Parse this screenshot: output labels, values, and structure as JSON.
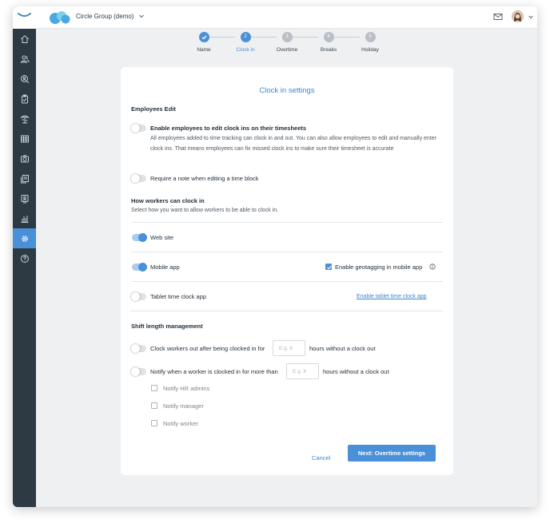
{
  "header": {
    "company_name": "Circle Group (demo)"
  },
  "sidebar": {
    "items": [
      {
        "icon": "home-icon"
      },
      {
        "icon": "users-icon"
      },
      {
        "icon": "search-user-icon"
      },
      {
        "icon": "clipboard-icon"
      },
      {
        "icon": "vacation-icon"
      },
      {
        "icon": "schedule-grid-icon"
      },
      {
        "icon": "camera-icon"
      },
      {
        "icon": "documents-icon"
      },
      {
        "icon": "id-badge-icon"
      },
      {
        "icon": "reports-chart-icon"
      },
      {
        "icon": "settings-gear-icon",
        "active": true
      },
      {
        "icon": "help-icon"
      }
    ]
  },
  "steps": [
    {
      "label": "Name",
      "state": "done",
      "num": ""
    },
    {
      "label": "Clock in",
      "state": "current",
      "num": "2"
    },
    {
      "label": "Overtime",
      "state": "todo",
      "num": "3"
    },
    {
      "label": "Breaks",
      "state": "todo",
      "num": "4"
    },
    {
      "label": "Holiday",
      "state": "todo",
      "num": "5"
    }
  ],
  "card": {
    "title": "Clock in settings",
    "employees_edit": {
      "heading": "Employees Edit",
      "enable_edit_label": "Enable employees to edit clock ins on their timesheets",
      "enable_edit_desc": "All employees added to time tracking can clock in and out. You can also allow employees to edit and manually enter clock ins. That means employees can fix missed clock ins to make sure their timesheet is accurate",
      "enable_edit_on": false,
      "require_note_label": "Require a note when editing a time block",
      "require_note_on": false
    },
    "clock_in_methods": {
      "heading": "How workers can clock in",
      "subheading": "Select how you want to allow workers to be able to clock in.",
      "web_label": "Web site",
      "web_on": true,
      "mobile_label": "Mobile app",
      "mobile_on": true,
      "geotag_label": "Enable geotagging in mobile app",
      "geotag_checked": true,
      "tablet_label": "Tablet time clock app",
      "tablet_on": false,
      "tablet_link": "Enable tablet time clock app"
    },
    "shift_length": {
      "heading": "Shift length management",
      "clock_out_label_pre": "Clock workers out after being clocked in for",
      "clock_out_placeholder": "E.g. 8",
      "clock_out_label_post": "hours without a clock out",
      "notify_label_pre": "Notify when a worker is clocked in for more than",
      "notify_placeholder": "E.g. 8",
      "notify_label_post": "hours without a clock out",
      "notify_options": [
        "Notify HR admins",
        "Notify manager",
        "Notify worker"
      ]
    },
    "actions": {
      "cancel": "Cancel",
      "next": "Next: Overtime settings"
    }
  },
  "colors": {
    "accent": "#4a90d9",
    "sidebar": "#2d3a44"
  }
}
